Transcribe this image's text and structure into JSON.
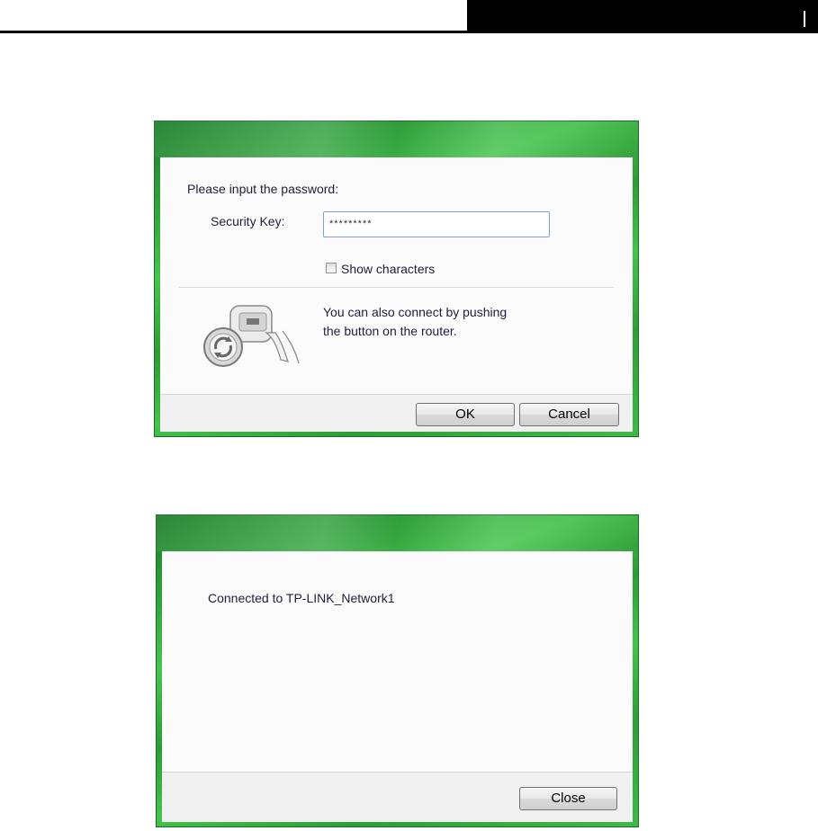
{
  "password_dialog": {
    "prompt": "Please input the password:",
    "security_key_label": "Security Key:",
    "security_key_value": "*********",
    "show_characters_label": "Show characters",
    "show_characters_checked": false,
    "wps_hint_line1": "You can also connect by pushing",
    "wps_hint_line2": "the button on the router.",
    "ok_label": "OK",
    "cancel_label": "Cancel"
  },
  "connected_dialog": {
    "message": "Connected to TP-LINK_Network1",
    "close_label": "Close"
  },
  "colors": {
    "frame_green": "#3fb84a",
    "text": "#1f1f3a"
  },
  "icons": {
    "wps": "wps-router-push-icon"
  }
}
